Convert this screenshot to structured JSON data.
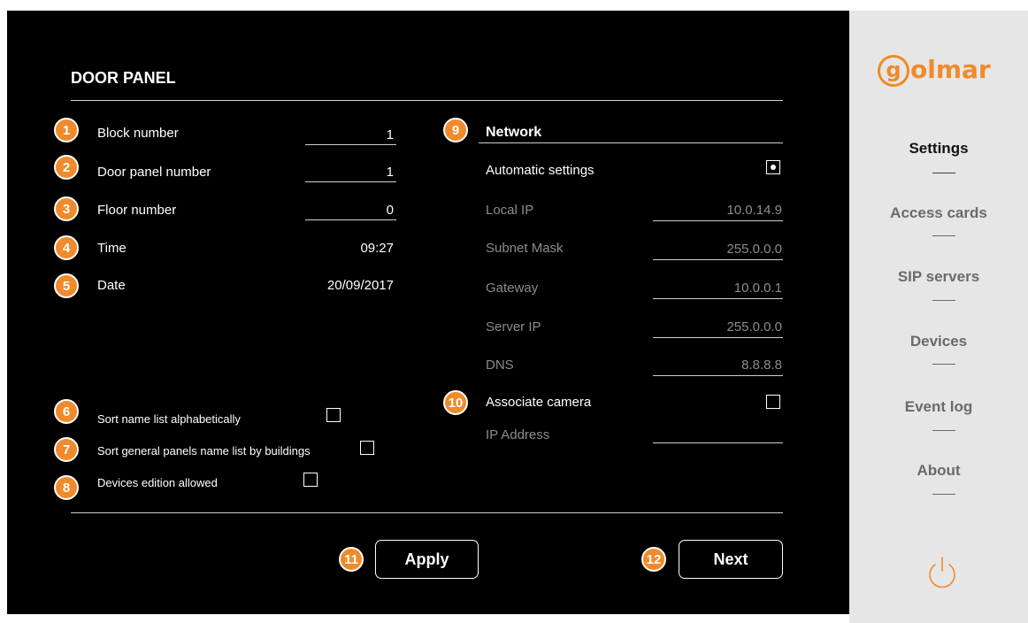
{
  "panel": {
    "title": "DOOR PANEL",
    "rows": [
      {
        "badge": "1",
        "label": "Block number",
        "value": "1"
      },
      {
        "badge": "2",
        "label": "Door panel number",
        "value": "1"
      },
      {
        "badge": "3",
        "label": "Floor number",
        "value": "0"
      },
      {
        "badge": "4",
        "label": "Time",
        "value": "09:27"
      },
      {
        "badge": "5",
        "label": "Date",
        "value": "20/09/2017"
      }
    ],
    "options": [
      {
        "badge": "6",
        "label": "Sort name list alphabetically",
        "checked": false
      },
      {
        "badge": "7",
        "label": "Sort general panels name list by buildings",
        "checked": false
      },
      {
        "badge": "8",
        "label": "Devices edition allowed",
        "checked": false
      }
    ]
  },
  "network": {
    "badge": "9",
    "title": "Network",
    "automatic_label": "Automatic settings",
    "automatic_selected": true,
    "fields": [
      {
        "label": "Local IP",
        "value": "10.0.14.9"
      },
      {
        "label": "Subnet Mask",
        "value": "255.0.0.0"
      },
      {
        "label": "Gateway",
        "value": "10.0.0.1"
      },
      {
        "label": "Server IP",
        "value": "255.0.0.0"
      },
      {
        "label": "DNS",
        "value": "8.8.8.8"
      }
    ],
    "camera_badge": "10",
    "associate_camera_label": "Associate camera",
    "associate_camera_checked": false,
    "ip_address_label": "IP Address",
    "ip_address_value": ""
  },
  "actions": {
    "apply_badge": "11",
    "apply_label": "Apply",
    "next_badge": "12",
    "next_label": "Next"
  },
  "sidebar": {
    "logo_text": "golmar",
    "items": [
      {
        "label": "Settings",
        "active": true
      },
      {
        "label": "Access cards",
        "active": false
      },
      {
        "label": "SIP servers",
        "active": false
      },
      {
        "label": "Devices",
        "active": false
      },
      {
        "label": "Event log",
        "active": false
      },
      {
        "label": "About",
        "active": false
      }
    ],
    "power_icon": "power-icon"
  },
  "colors": {
    "accent": "#f08a2a",
    "background": "#000000",
    "sidebar_bg": "#e6e6e6"
  }
}
